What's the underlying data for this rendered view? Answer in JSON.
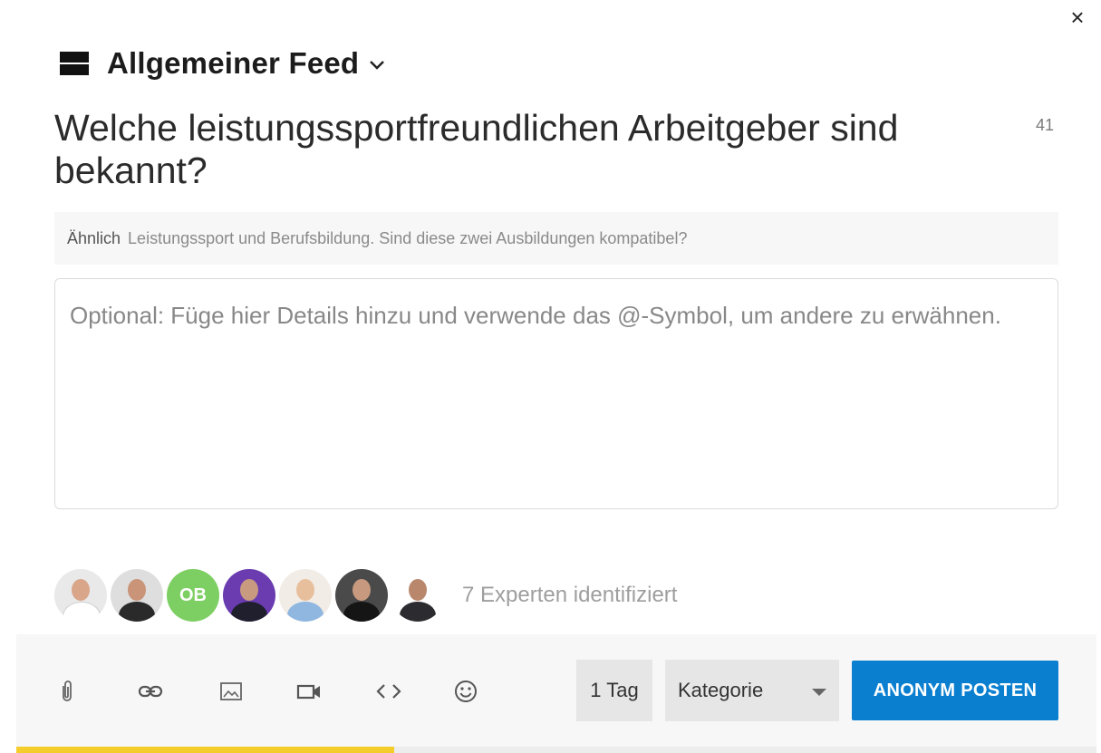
{
  "dialog": {
    "close_icon": "close-icon"
  },
  "header": {
    "feed_title": "Allgemeiner Feed",
    "feed_icon": "feed-icon",
    "dropdown_icon": "chevron-down-icon"
  },
  "question": {
    "title": "Welche leistungssportfreundlichen Arbeitgeber sind bekannt?",
    "char_count": "41"
  },
  "similar": {
    "label": "Ähnlich",
    "link": "Leistungssport und Berufsbildung. Sind diese zwei Ausbildungen kompatibel?"
  },
  "details": {
    "placeholder": "Optional: Füge hier Details hinzu und verwende das @-Symbol, um andere zu erwähnen."
  },
  "experts": {
    "initials_avatar": "OB",
    "summary": "7 Experten identifiziert"
  },
  "toolbar": {
    "icons": [
      "paperclip-icon",
      "link-icon",
      "image-icon",
      "video-icon",
      "code-icon",
      "emoji-icon"
    ],
    "duration_label": "1 Tag",
    "category_label": "Kategorie",
    "post_label": "ANONYM POSTEN"
  },
  "progress": {
    "fraction": 0.35
  },
  "colors": {
    "accent": "#0a7fd0",
    "progress": "#f4cd2a",
    "avatar_green": "#7dcf63"
  }
}
